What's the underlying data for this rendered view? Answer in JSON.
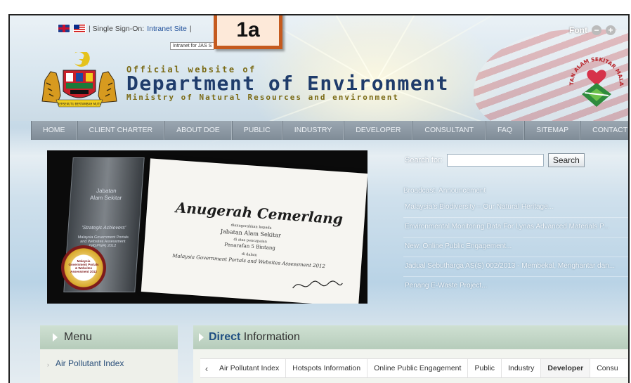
{
  "topbar": {
    "single_sign_on_prefix": "| Single Sign-On: ",
    "intranet_link": "Intranet Site",
    "separator_after": " |",
    "intranet_tooltip": "Intranet for JAS S"
  },
  "callout_label": "1a",
  "font_control": {
    "label": "Font",
    "decrease": "−",
    "increase": "+"
  },
  "site": {
    "subtitle_top": "Official website of",
    "title": "Department of Environment",
    "subtitle_bottom": "Ministry of Natural Resources and environment",
    "crest_motto": "BERSEKUTU BERTAMBAH MUTU",
    "logo_text": "JABATAN ALAM SEKITAR MALAYSIA"
  },
  "nav": {
    "items": [
      "HOME",
      "CLIENT CHARTER",
      "ABOUT DOE",
      "PUBLIC",
      "INDUSTRY",
      "DEVELOPER",
      "CONSULTANT",
      "FAQ",
      "SITEMAP",
      "CONTACT"
    ]
  },
  "banner": {
    "trophy_line1": "Jabatan",
    "trophy_line2": "Alam Sekitar",
    "trophy_line3": "'Strategic Achievers'",
    "trophy_line4": "Malaysia Government Portals and Websites Assessment (MGPWA) 2012",
    "seal_text": "Malaysia Government Portals & Websites Assessment 2012",
    "cert_title": "Anugerah Cemerlang",
    "cert_presented": "dianugerahkan kepada",
    "cert_recipient": "Jabatan Alam Sekitar",
    "cert_rating_pre": "di atas pencapaian",
    "cert_rating": "Penarafan 5 Bintang",
    "cert_in": "di dalam",
    "cert_event": "Malaysia Government Portals and Websites Assessment 2012"
  },
  "search": {
    "label": "Search for:",
    "value": "",
    "button": "Search"
  },
  "broadcast": {
    "heading": "Broadcast: Announcement",
    "items": [
      "Malaysia's Biodiversity – Our Natural Heritage...",
      "Environmental Monitoring Data For Lynas Advanced Materials P...",
      "New: Online Public Engagement...",
      "Jadual Sebutharga AS(S) 002/2013 - Membekal, Menghantar dan...",
      "Penang E-Waste Project..."
    ]
  },
  "menu": {
    "title": "Menu",
    "first_item": "Air Pollutant Index"
  },
  "direct": {
    "title_bold": "Direct",
    "title_rest": " Information",
    "prev": "‹",
    "next": "›",
    "tabs": [
      "Air Pollutant Index",
      "Hotspots Information",
      "Online Public Engagement",
      "Public",
      "Industry",
      "Developer",
      "Consu"
    ],
    "active_tab": "Developer"
  }
}
